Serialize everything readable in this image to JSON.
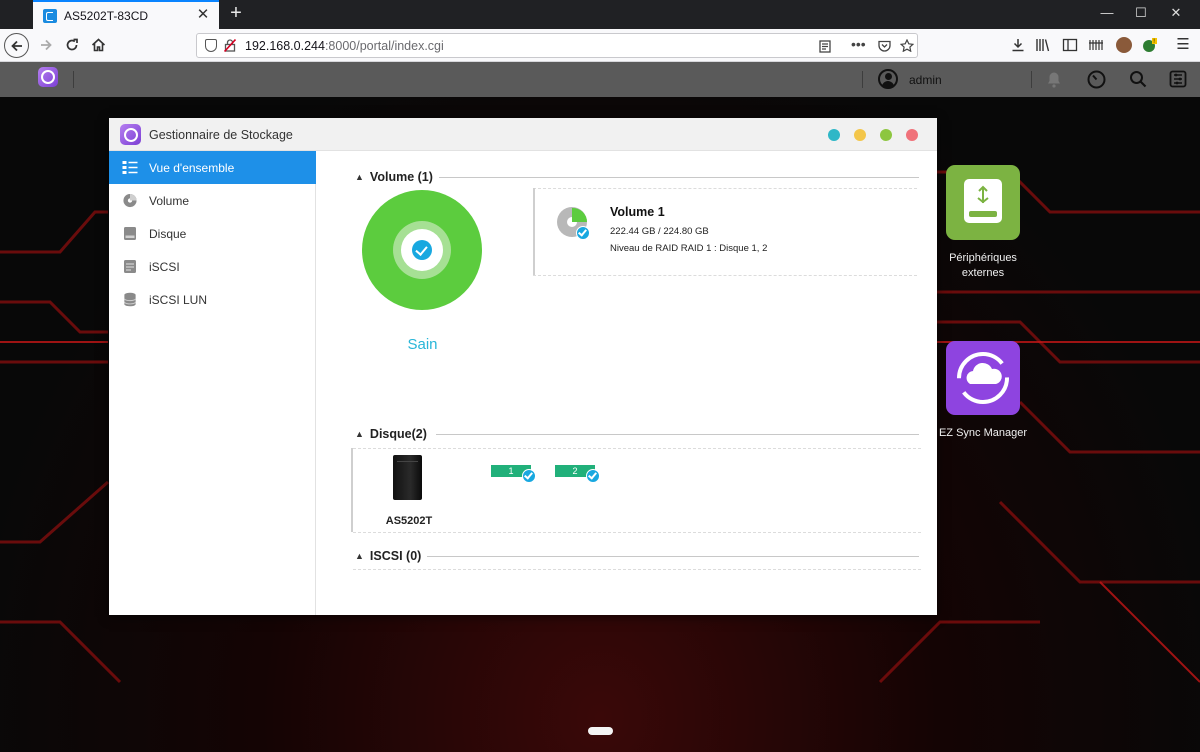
{
  "browser": {
    "tab_title": "AS5202T-83CD",
    "new_tab": "+",
    "close_glyph": "✕",
    "url_host": "192.168.0.244",
    "url_path": ":8000/portal/index.cgi",
    "window_controls": [
      "—",
      "☐",
      "✕"
    ]
  },
  "topbar": {
    "username": "admin"
  },
  "window": {
    "title": "Gestionnaire de Stockage",
    "dot_colors": [
      "#2fb7c7",
      "#f3c64a",
      "#8dc63f",
      "#f0727a"
    ]
  },
  "sidebar": {
    "items": [
      {
        "label": "Vue d'ensemble",
        "icon": "overview-icon"
      },
      {
        "label": "Volume",
        "icon": "volume-icon"
      },
      {
        "label": "Disque",
        "icon": "disk-icon"
      },
      {
        "label": "iSCSI",
        "icon": "iscsi-icon"
      },
      {
        "label": "iSCSI LUN",
        "icon": "iscsi-lun-icon"
      }
    ]
  },
  "volume_section": {
    "header": "Volume (1)",
    "status": "Sain",
    "card": {
      "name": "Volume 1",
      "size": "222.44 GB / 224.80 GB",
      "raid": "Niveau de RAID RAID 1 : Disque 1, 2"
    }
  },
  "disk_section": {
    "header": "Disque(2)",
    "device": "AS5202T",
    "disks": [
      "1",
      "2"
    ]
  },
  "iscsi_section": {
    "header": "ISCSI (0)"
  },
  "desktop_apps": [
    {
      "label": "Périphériques externes",
      "color": "#7cb342"
    },
    {
      "label": "EZ Sync Manager",
      "color": "#8e44e0"
    }
  ],
  "colors": {
    "accent": "#1e90e8",
    "healthy": "#5ccc3e",
    "status_text": "#29b6d8",
    "disk_ok": "#21b07a"
  }
}
